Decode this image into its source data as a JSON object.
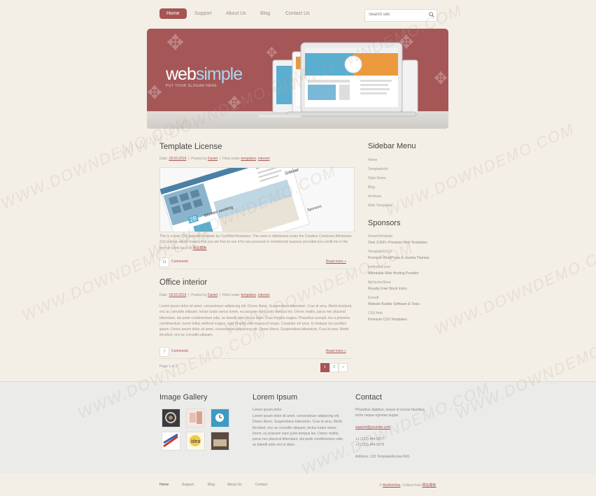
{
  "nav": {
    "items": [
      "Home",
      "Support",
      "About Us",
      "Blog",
      "Contact Us"
    ]
  },
  "search": {
    "placeholder": "Search site"
  },
  "banner": {
    "logo_part1": "web",
    "logo_part2": "simple",
    "slogan": "PUT YOUR SLOGAN HERE"
  },
  "posts": [
    {
      "title": "Template License",
      "meta_date_label": "Date:",
      "meta_date": "18.03.2016",
      "meta_posted_label": "Posted by",
      "meta_author": "Daniel",
      "meta_filed_label": "Filed under",
      "meta_tag1": "templates",
      "meta_tag2": "internet",
      "text": "This is a free CSS website template by CoolWebTemplates. This work is distributed under the Creative Commons Attribution 3.0 License, which means that you are free to use it for any personal or commercial purpose provided you credit me in the form of a link back to",
      "text_link": "网站模板",
      "comments_count": "11",
      "comments_label": "Comments",
      "readmore": "Read more »"
    },
    {
      "title": "Office interior",
      "meta_date_label": "Date:",
      "meta_date": "18.03.2016",
      "meta_posted_label": "Posted by",
      "meta_author": "Daniel",
      "meta_filed_label": "Filed under",
      "meta_tag1": "templates",
      "meta_tag2": "internet",
      "text": "Lorem ipsum dolor sit amet, consectetuer adipiscing elit. Donec libero. Suspendisse bibendum. Cras id urna. Morbi tincidunt, orci ac convallis aliquam, lectus turpis varius lorem, eu posuere nunc justo tempus leo. Donec mattis, purus nec placerat bibendum, dui pede condimentum odio, ac blandit ante orci ut diam. Cras fringilla magna. Phasellus suscipit, leo a pharetra condimentum, lorem tellus eleifend magna, eget fringilla velit magna id neque. Curabitur vel urna. In tristique orci porttitor ipsum. Donec ipsum dolor sit amet, consectetuer adipiscing elit. Donec libero. Suspendisse bibendum. Cras id urna. Morbi tincidunt, orci ac convallis aliquam.",
      "comments_count": "7",
      "comments_label": "Comments",
      "readmore": "Read more »"
    }
  ],
  "post_image": {
    "caption": "Women working",
    "date_day": "28",
    "side_title": "Sidebar",
    "side_sponsors": "Sponsors"
  },
  "pagination": {
    "info": "Page 1 of 3",
    "pages": [
      "1",
      "2",
      "»"
    ]
  },
  "sidebar": {
    "menu_title": "Sidebar Menu",
    "menu_items": [
      "Home",
      "TemplateInfo",
      "Style Demo",
      "Blog",
      "Archives",
      "Web Templates"
    ],
    "sponsors_title": "Sponsors",
    "sponsors": [
      {
        "name": "DreamTemplate",
        "desc": "Over 6,000+ Premium Web Templates"
      },
      {
        "name": "TemplateSOLD",
        "desc": "Premium WordPress & Joomla Themes"
      },
      {
        "name": "ImHosted.com",
        "desc": "Affordable Web Hosting Provider"
      },
      {
        "name": "MyVectorStore",
        "desc": "Royalty Free Stock Icons"
      },
      {
        "name": "Evrsoft",
        "desc": "Website Builder Software & Tools"
      },
      {
        "name": "CSS Hub",
        "desc": "Premium CSS Templates"
      }
    ]
  },
  "footer": {
    "gallery_title": "Image Gallery",
    "lorem_title": "Lorem Ipsum",
    "lorem_subtitle": "Lorem ipsum dolor",
    "lorem_text": "Lorem ipsum dolor sit amet, consectetuer adipiscing elit. Donec libero. Suspendisse bibendum. Cras id urna. Morbi tincidunt, orci ac convallis aliquam, lectus turpis varius lorem, eu posuere nunc justo tempus leo. Donec mattis, purus nec placerat bibendum, dui pede condimentum odio, ac blandit ante orci ut diam.",
    "contact_title": "Contact",
    "contact_text": "Phasellus dapibus, neque id cursus faucibus, tortor neque egestas augue.",
    "contact_email": "support@yoursite.com",
    "contact_phone": "+1 (123) 444-5677",
    "contact_fax": "+1 (123) 444-5679",
    "contact_address": "Address: 123 TemplateAccess Rd1"
  },
  "bottom_nav": {
    "items": [
      "Home",
      "Support",
      "Blog",
      "About Us",
      "Contact"
    ],
    "copy_prefix": "©",
    "copy_site": "MyWebSite",
    "copy_mid": ". Collect from",
    "copy_link": "网站模板"
  },
  "watermark": "WWW.DOWNDEMO.COM",
  "colors": {
    "accent": "#a65454",
    "background": "#f4efe6",
    "footer_bg": "#ebebe9",
    "logo_blue": "#a8d7ef"
  }
}
